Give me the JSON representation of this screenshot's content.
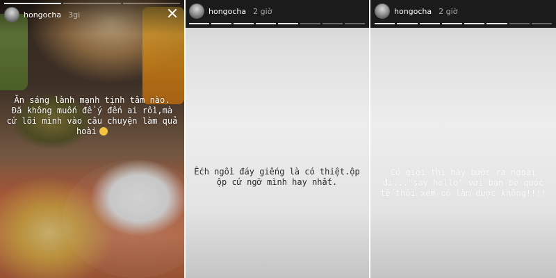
{
  "stories": [
    {
      "username": "hongocha",
      "time": "3gi",
      "caption": "Ăn sáng lành mạnh tịnh tâm nào.\nĐã không muốn để ý đến ai rồi,mà cứ lôi mình vào câu chuyện làm quả hoài",
      "progress": {
        "segments": 3,
        "done": 1
      },
      "background": "food-photo"
    },
    {
      "username": "hongocha",
      "time": "2 giờ",
      "caption": "Ếch ngồi đáy giếng là có thiệt.ộp ộp cứ ngỡ mình hay nhất.",
      "progress": {
        "segments": 8,
        "done": 5
      },
      "background": "grey-gradient"
    },
    {
      "username": "hongocha",
      "time": "2 giờ",
      "caption": "Có giỏi thì hãy bước ra ngoài đi...\"say hello\" với bạn bè quốc tế thôi xem có làm được không!!!!",
      "progress": {
        "segments": 8,
        "done": 6
      },
      "background": "grey-gradient"
    }
  ],
  "icons": {
    "close": "close-icon",
    "menu": "more-dots-icon",
    "emoji": "smirk-emoji-icon"
  }
}
